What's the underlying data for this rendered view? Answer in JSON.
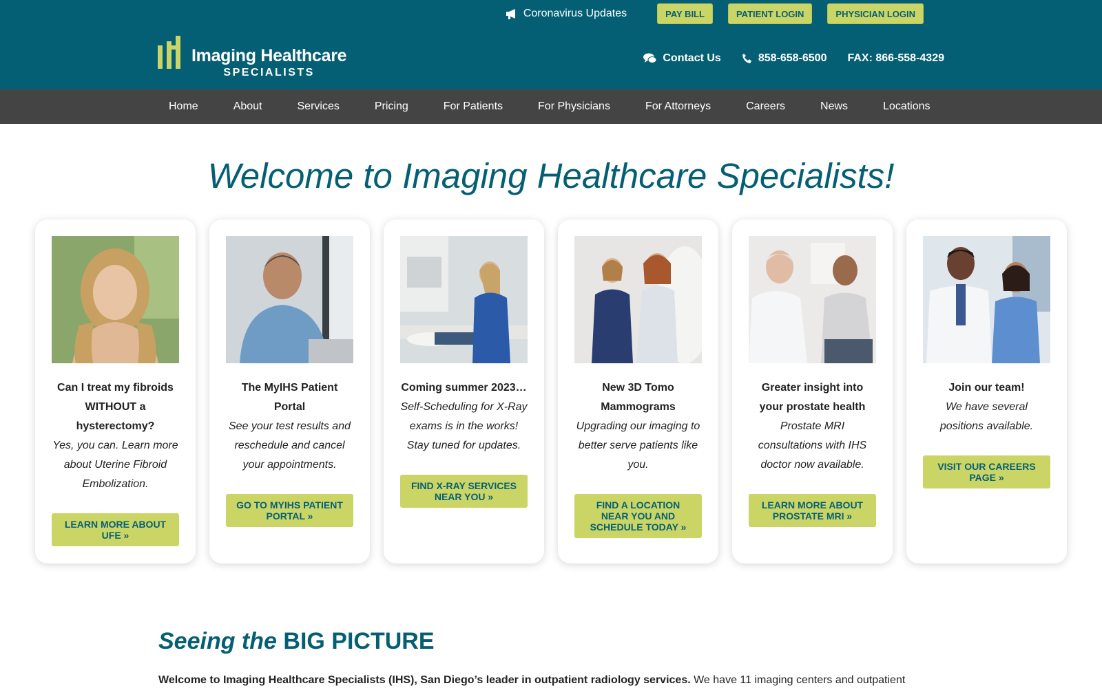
{
  "header": {
    "util_link": "Coronavirus Updates",
    "pay_bill": "PAY BILL",
    "patient_login": "PATIENT LOGIN",
    "physician_login": "PHYSICIAN LOGIN",
    "contact_us": "Contact Us",
    "phone": "858-658-6500",
    "fax": "FAX: 866-558-4329",
    "logo_title": "Imaging Healthcare",
    "logo_sub": "SPECIALISTS",
    "bg_color": "#055f74",
    "accent_color": "#cad566"
  },
  "nav": {
    "items": [
      "Home",
      "About",
      "Services",
      "Pricing",
      "For Patients",
      "For Physicians",
      "For Attorneys",
      "Careers",
      "News",
      "Locations"
    ]
  },
  "welcome": "Welcome to Imaging Healthcare Specialists!",
  "cards": [
    {
      "title": "Can I treat my fibroids WITHOUT a hysterectomy?",
      "text": "Yes, you can. Learn more about Uterine Fibroid Embolization.",
      "button": "LEARN MORE ABOUT UFE",
      "image": "woman-portrait"
    },
    {
      "title": "The MyIHS Patient Portal",
      "text": "See your test results and reschedule and cancel your appointments.",
      "button": "GO TO MYIHS PATIENT PORTAL",
      "image": "man-with-laptop"
    },
    {
      "title": "Coming summer 2023…",
      "text": "Self-Scheduling for X-Ray exams is in the works! Stay tuned for updates.",
      "button": "FIND X-RAY SERVICES NEAR YOU",
      "image": "xray-technician"
    },
    {
      "title": "New 3D Tomo Mammograms",
      "text": "Upgrading our imaging to better serve patients like you.",
      "button": "FIND A LOCATION NEAR YOU AND SCHEDULE TODAY",
      "image": "mammogram"
    },
    {
      "title": "Greater insight into your prostate health",
      "text": "Prostate MRI consultations with IHS doctor now available.",
      "button": "LEARN MORE ABOUT PROSTATE MRI",
      "image": "doctor-consult"
    },
    {
      "title": "Join our team!",
      "text": "We have several positions available.",
      "button": "VISIT OUR CAREERS PAGE",
      "image": "medical-team"
    }
  ],
  "big_picture": {
    "title_italic": "Seeing the",
    "title_bold": "BIG PICTURE",
    "intro_bold": "Welcome to Imaging Healthcare Specialists (IHS), San Diego’s leader in outpatient radiology services.",
    "intro_rest": " We have 11 imaging centers and outpatient"
  }
}
